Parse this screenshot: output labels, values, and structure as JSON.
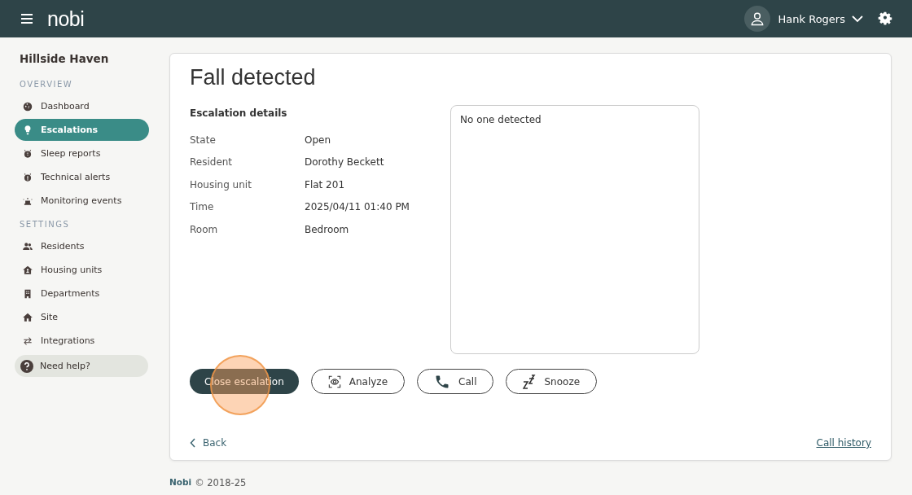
{
  "header": {
    "logo": "nobi",
    "user": "Hank Rogers"
  },
  "sidebar": {
    "site": "Hillside Haven",
    "sections": [
      {
        "title": "OVERVIEW",
        "items": [
          {
            "label": "Dashboard",
            "selected": false
          },
          {
            "label": "Escalations",
            "selected": true
          },
          {
            "label": "Sleep reports",
            "selected": false
          },
          {
            "label": "Technical alerts",
            "selected": false
          },
          {
            "label": "Monitoring events",
            "selected": false
          }
        ]
      },
      {
        "title": "SETTINGS",
        "items": [
          {
            "label": "Residents",
            "selected": false
          },
          {
            "label": "Housing units",
            "selected": false
          },
          {
            "label": "Departments",
            "selected": false
          },
          {
            "label": "Site",
            "selected": false
          },
          {
            "label": "Integrations",
            "selected": false
          }
        ]
      }
    ],
    "help": "Need help?"
  },
  "escalation": {
    "title": "Fall detected",
    "details_title": "Escalation details",
    "details": [
      {
        "label": "State",
        "value": "Open"
      },
      {
        "label": "Resident",
        "value": "Dorothy Beckett"
      },
      {
        "label": "Housing unit",
        "value": "Flat 201"
      },
      {
        "label": "Time",
        "value": "2025/04/11 01:40 PM"
      },
      {
        "label": "Room",
        "value": "Bedroom"
      }
    ],
    "camera_text": "No one detected",
    "buttons": [
      {
        "label": "Close escalation",
        "kind": "primary"
      },
      {
        "label": "Analyze",
        "kind": "analyze"
      },
      {
        "label": "Call",
        "kind": "call"
      },
      {
        "label": "Snooze",
        "kind": "snooze"
      }
    ],
    "back": "Back",
    "call_history": "Call history"
  },
  "footer": {
    "brand": "Nobi",
    "copyright": "© 2018-25"
  }
}
